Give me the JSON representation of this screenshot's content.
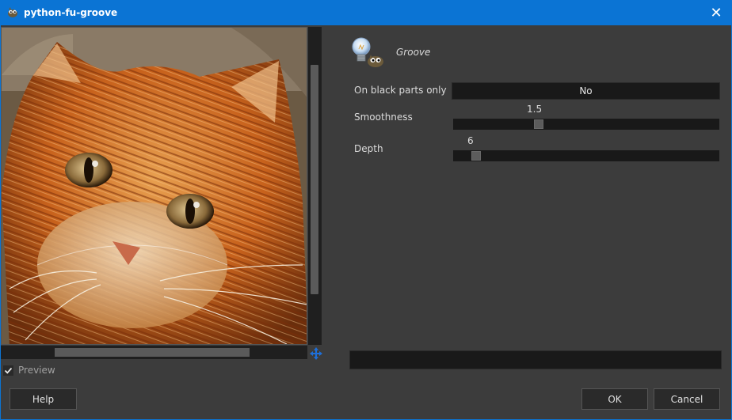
{
  "window": {
    "title": "python-fu-groove",
    "close_symbol": "✕"
  },
  "icons": {
    "app": "gimp-wilber-icon",
    "close": "close-icon",
    "procedure": "python-fu-lightbulb-icon",
    "navigate": "move-arrows-icon",
    "check": "checkmark-icon"
  },
  "preview": {
    "label": "Preview",
    "checked": true,
    "image": "orange tabby cat embossed groove effect"
  },
  "procedure": {
    "name": "Groove"
  },
  "fields": {
    "black_parts": {
      "label": "On black parts only",
      "value": "No"
    },
    "smoothness": {
      "label": "Smoothness",
      "value": "1.5",
      "fraction": 0.305
    },
    "depth": {
      "label": "Depth",
      "value": "6",
      "fraction": 0.068
    }
  },
  "progress": {
    "value": 0
  },
  "buttons": {
    "help": "Help",
    "ok": "OK",
    "cancel": "Cancel"
  },
  "colors": {
    "accent": "#0b74d4",
    "background": "#3c3c3c",
    "field": "#191919"
  }
}
